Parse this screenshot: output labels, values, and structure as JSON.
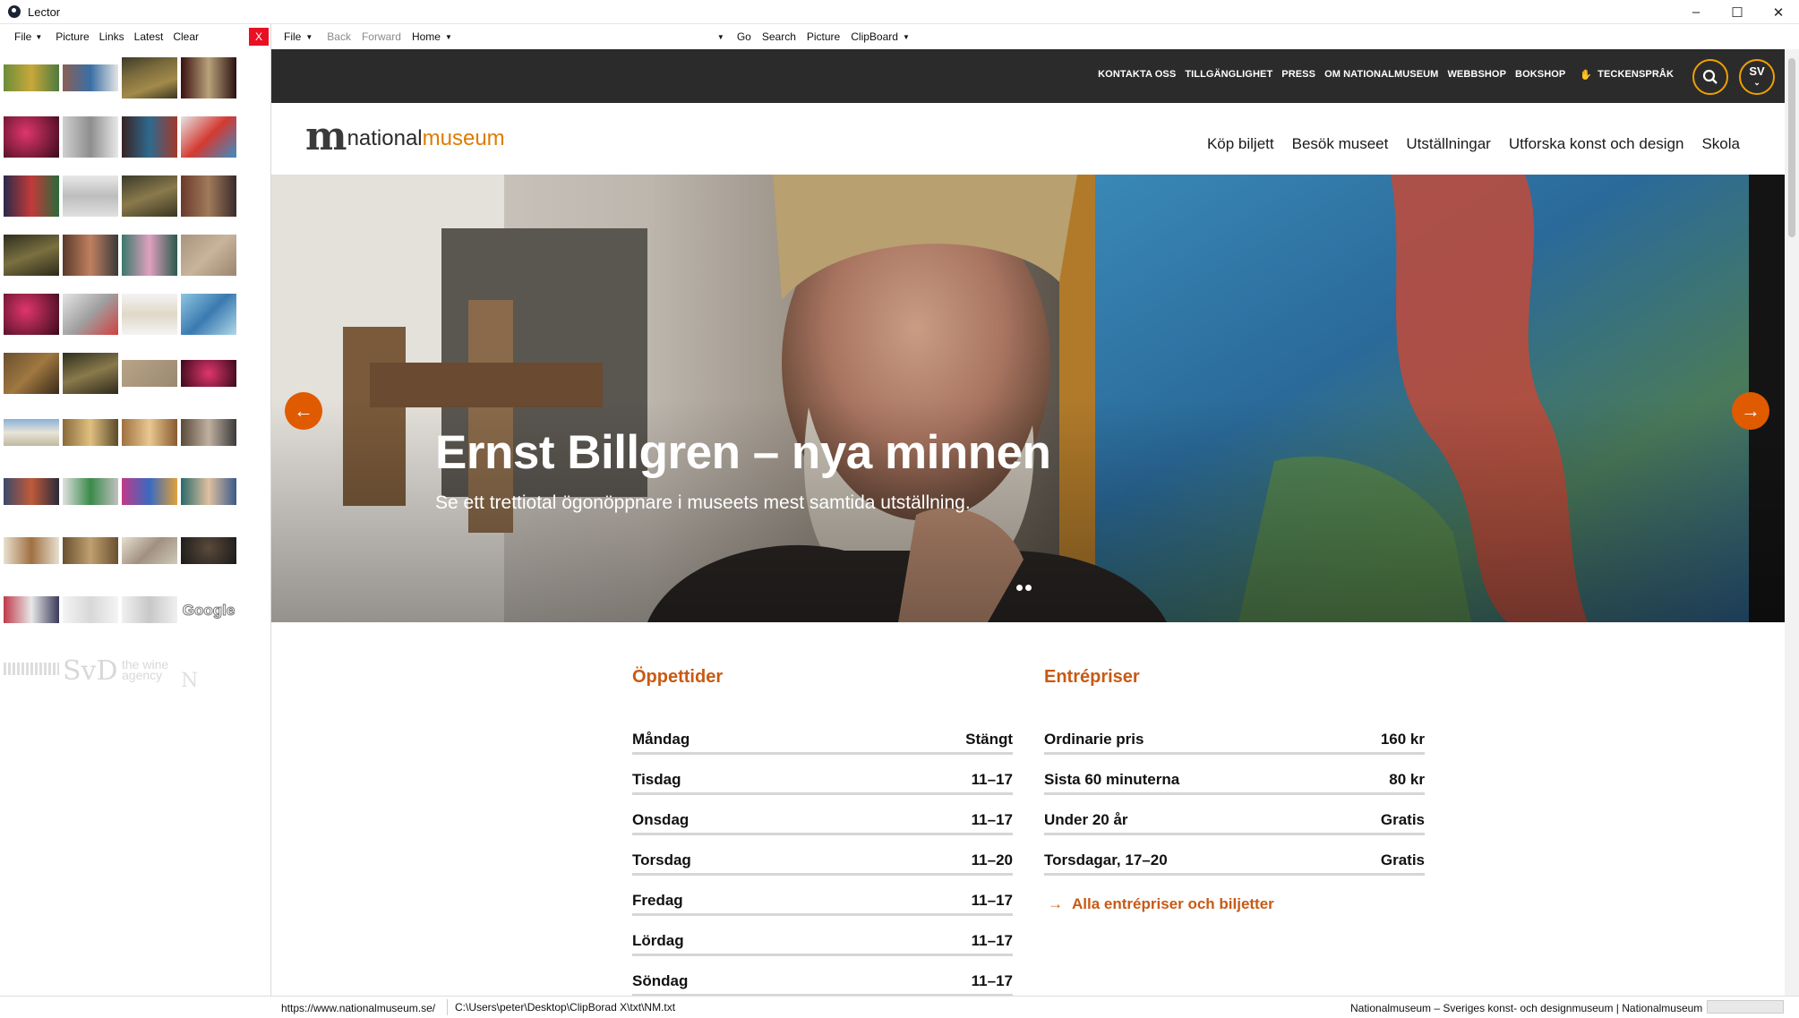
{
  "window": {
    "title": "Lector",
    "controls": {
      "minimize": "–",
      "maximize": "☐",
      "close": "✕"
    }
  },
  "left_menu": {
    "file": "File",
    "picture": "Picture",
    "links": "Links",
    "latest": "Latest",
    "clear": "Clear",
    "close": "X"
  },
  "thumbnails": {
    "google_text": "Google",
    "svd_text": "SvD",
    "wine_text": "the wine agency",
    "nm_text": "N"
  },
  "right_menu": {
    "file": "File",
    "back": "Back",
    "forward": "Forward",
    "home": "Home",
    "go": "Go",
    "search": "Search",
    "picture": "Picture",
    "clipboard": "ClipBoard"
  },
  "site": {
    "top_links": [
      "KONTAKTA OSS",
      "TILLGÄNGLIGHET",
      "PRESS",
      "OM NATIONALMUSEUM",
      "WEBBSHOP",
      "BOKSHOP",
      "TECKENSPRÅK"
    ],
    "lang": "SV",
    "logo": {
      "mark": "m",
      "part1": "national",
      "part2": "museum"
    },
    "nav": [
      "Köp biljett",
      "Besök museet",
      "Utställningar",
      "Utforska konst och design",
      "Skola"
    ],
    "hero": {
      "title": "Ernst Billgren – nya minnen",
      "subtitle": "Se ett trettiotal ögonöppnare i museets mest samtida utställning."
    },
    "hours": {
      "heading": "Öppettider",
      "rows": [
        {
          "day": "Måndag",
          "time": "Stängt"
        },
        {
          "day": "Tisdag",
          "time": "11–17"
        },
        {
          "day": "Onsdag",
          "time": "11–17"
        },
        {
          "day": "Torsdag",
          "time": "11–20"
        },
        {
          "day": "Fredag",
          "time": "11–17"
        },
        {
          "day": "Lördag",
          "time": "11–17"
        },
        {
          "day": "Söndag",
          "time": "11–17"
        }
      ]
    },
    "prices": {
      "heading": "Entrépriser",
      "rows": [
        {
          "label": "Ordinarie pris",
          "value": "160 kr"
        },
        {
          "label": "Sista 60 minuterna",
          "value": "80 kr"
        },
        {
          "label": "Under 20 år",
          "value": "Gratis"
        },
        {
          "label": "Torsdagar, 17–20",
          "value": "Gratis"
        }
      ],
      "link": "Alla entrépriser och biljetter"
    }
  },
  "status": {
    "url": "https://www.nationalmuseum.se/",
    "path": "C:\\Users\\peter\\Desktop\\ClipBorad X\\txt\\NM.txt",
    "page_title": "Nationalmuseum – Sveriges konst- och designmuseum | Nationalmuseum"
  },
  "colors": {
    "accent": "#c85a14",
    "topbar": "#2b2b2b",
    "arrow": "#e05a00",
    "ring": "#f0a000"
  }
}
